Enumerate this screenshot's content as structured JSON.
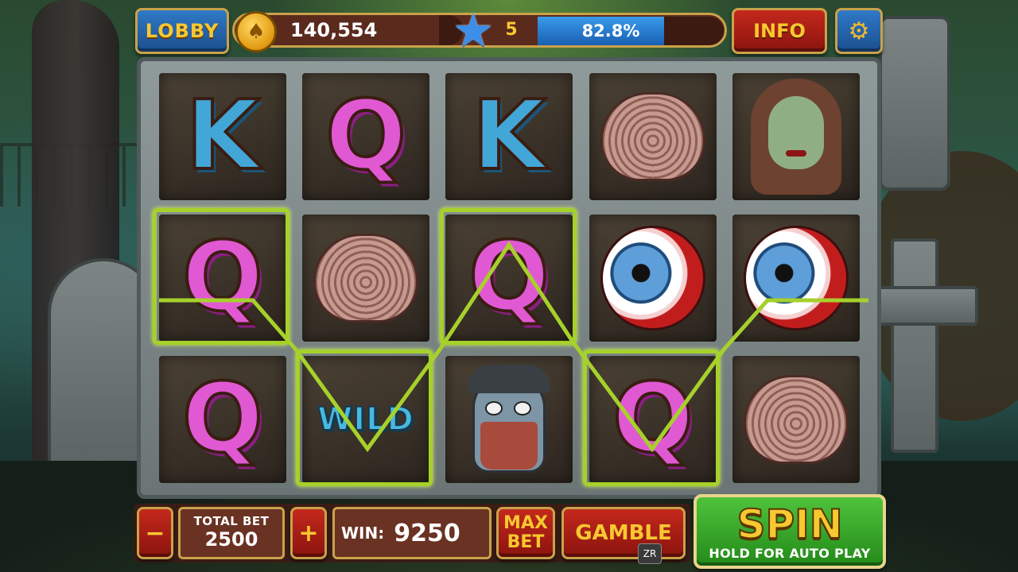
{
  "header": {
    "lobby_label": "LOBBY",
    "coins": "140,554",
    "level": "5",
    "xp_percent_text": "82.8%",
    "xp_fraction": 0.828,
    "info_label": "INFO"
  },
  "reels": {
    "grid": [
      [
        "K",
        "Q",
        "K",
        "brain",
        "zombie-girl"
      ],
      [
        "Q",
        "brain",
        "Q",
        "eyeball",
        "eyeball"
      ],
      [
        "Q",
        "WILD",
        "zombie-man",
        "Q",
        "brain"
      ]
    ],
    "wild_label": "WILD"
  },
  "footer": {
    "minus_label": "−",
    "plus_label": "+",
    "total_bet_label": "TOTAL BET",
    "total_bet_value": "2500",
    "win_label": "WIN:",
    "win_value": "9250",
    "max_label": "MAX",
    "bet_label": "BET",
    "gamble_label": "GAMBLE",
    "zr_label": "ZR",
    "spin_label": "SPIN",
    "spin_sub": "HOLD FOR AUTO PLAY"
  },
  "colors": {
    "win_line": "#a6d12b",
    "gold": "#f7c830"
  }
}
